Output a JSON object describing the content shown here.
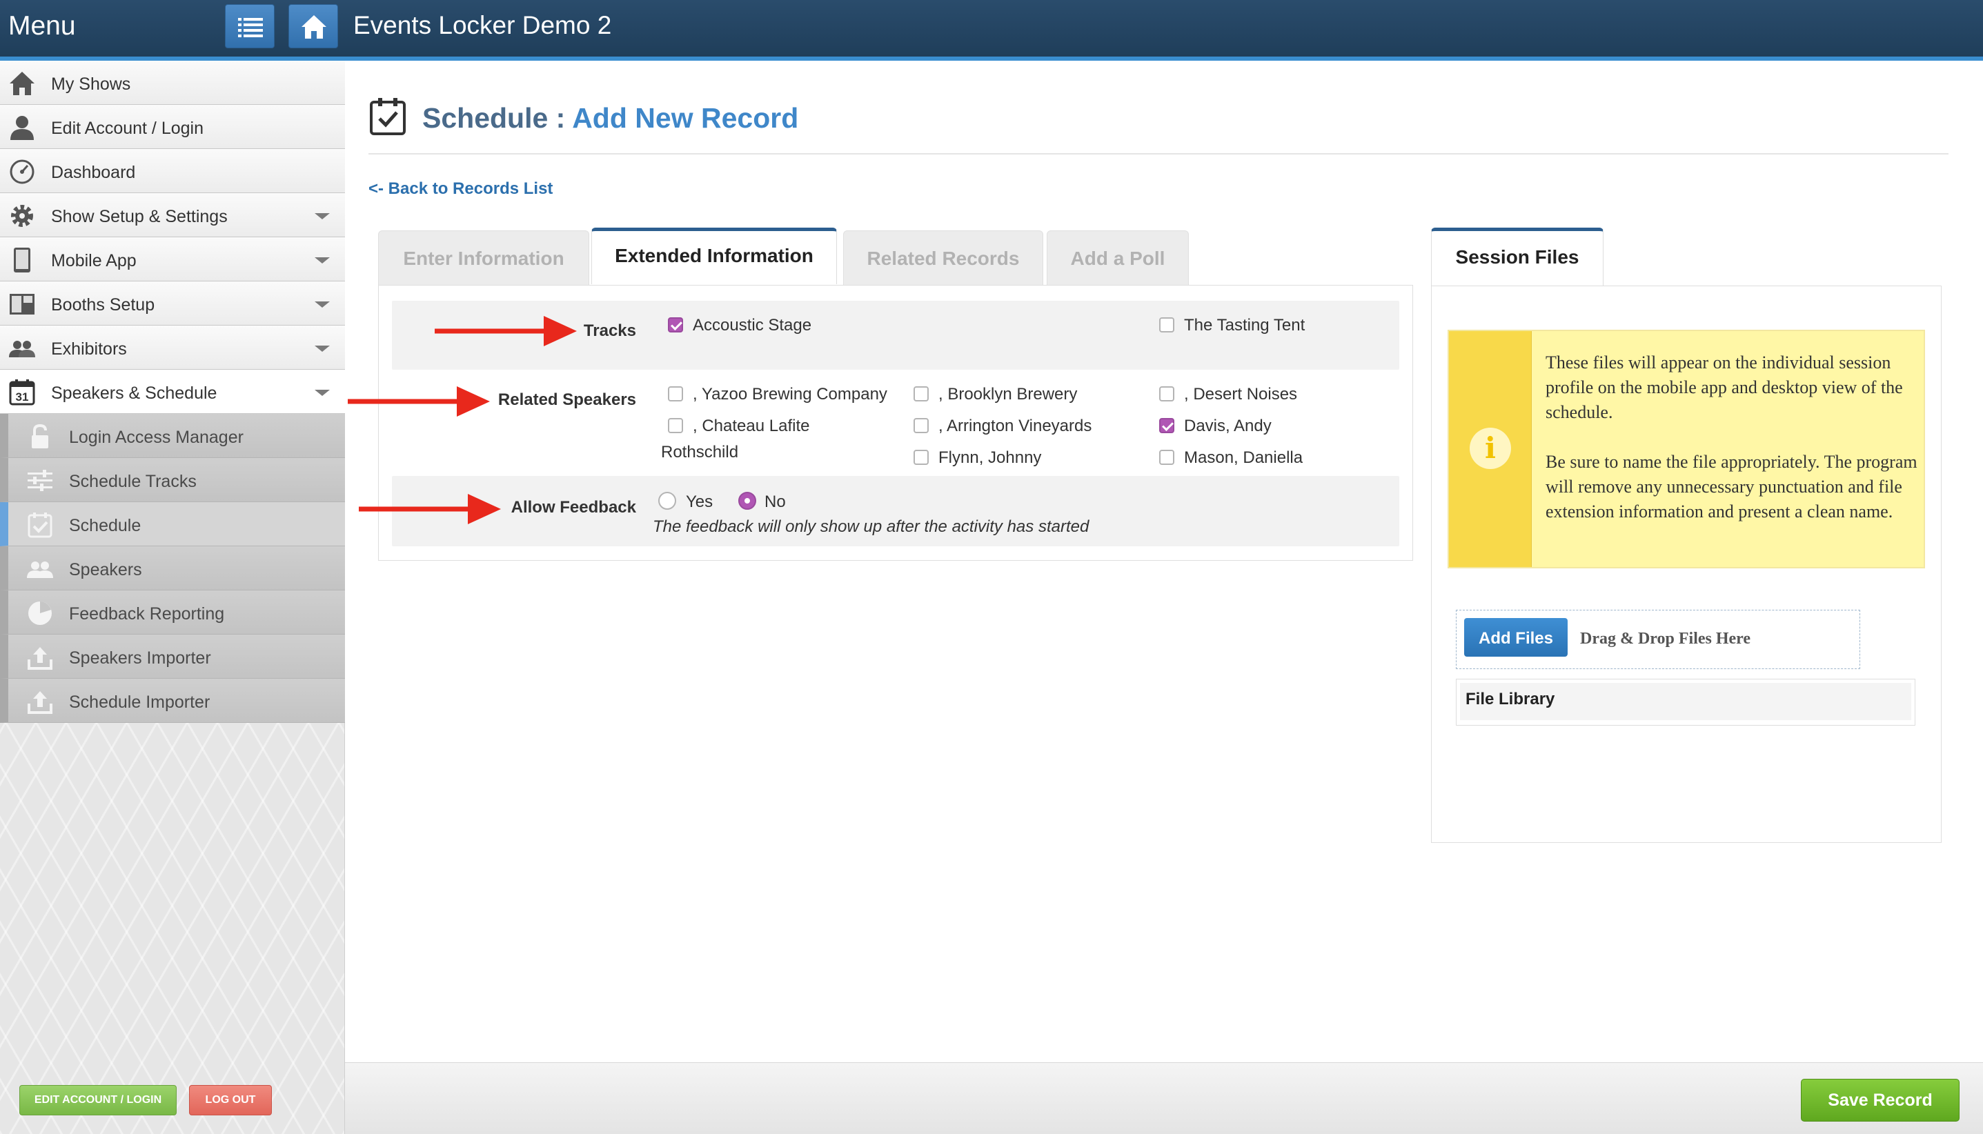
{
  "header": {
    "menu_label": "Menu",
    "app_title": "Events Locker Demo 2",
    "list_icon": "list-icon",
    "home_icon": "home-icon"
  },
  "sidebar": {
    "items": [
      {
        "label": "My Shows",
        "icon": "home-icon"
      },
      {
        "label": "Edit Account / Login",
        "icon": "person-icon"
      },
      {
        "label": "Dashboard",
        "icon": "gauge-icon"
      },
      {
        "label": "Show Setup & Settings",
        "icon": "gear-icon",
        "expandable": true
      },
      {
        "label": "Mobile App",
        "icon": "tablet-icon",
        "expandable": true
      },
      {
        "label": "Booths Setup",
        "icon": "layout-icon",
        "expandable": true
      },
      {
        "label": "Exhibitors",
        "icon": "people-icon",
        "expandable": true
      },
      {
        "label": "Speakers & Schedule",
        "icon": "calendar-icon",
        "icon_text": "31",
        "expandable": true,
        "expanded": true
      }
    ],
    "subitems": [
      {
        "label": "Login Access Manager",
        "icon": "lock-icon"
      },
      {
        "label": "Schedule Tracks",
        "icon": "sliders-icon"
      },
      {
        "label": "Schedule",
        "icon": "calendar-check-icon",
        "active": true
      },
      {
        "label": "Speakers",
        "icon": "people-icon"
      },
      {
        "label": "Feedback Reporting",
        "icon": "pie-chart-icon"
      },
      {
        "label": "Speakers Importer",
        "icon": "upload-icon"
      },
      {
        "label": "Schedule Importer",
        "icon": "upload-icon"
      }
    ],
    "edit_account_button": "EDIT ACCOUNT / LOGIN",
    "logout_button": "LOG OUT"
  },
  "page": {
    "title": "Schedule",
    "separator": " : ",
    "subtitle": "Add New Record",
    "back_link": "<- Back to Records List"
  },
  "tabs": [
    {
      "label": "Enter Information",
      "active": false
    },
    {
      "label": "Extended Information",
      "active": true
    },
    {
      "label": "Related Records",
      "active": false
    },
    {
      "label": "Add a Poll",
      "active": false
    }
  ],
  "form": {
    "tracks": {
      "label": "Tracks",
      "options": [
        {
          "label": "Accoustic Stage",
          "checked": true
        },
        {
          "label": "The Tasting Tent",
          "checked": false
        }
      ]
    },
    "related_speakers": {
      "label": "Related Speakers",
      "options": [
        {
          "label": ", Yazoo Brewing Company",
          "checked": false
        },
        {
          "label": ", Brooklyn Brewery",
          "checked": false
        },
        {
          "label": ", Desert Noises",
          "checked": false
        },
        {
          "label": ", Chateau Lafite",
          "label_cont": "Rothschild",
          "checked": false
        },
        {
          "label": ", Arrington Vineyards",
          "checked": false
        },
        {
          "label": "Davis, Andy",
          "checked": true
        },
        {
          "label": "Flynn, Johnny",
          "checked": false
        },
        {
          "label": "Mason, Daniella",
          "checked": false
        }
      ]
    },
    "allow_feedback": {
      "label": "Allow Feedback",
      "options": [
        {
          "label": "Yes",
          "selected": false
        },
        {
          "label": "No",
          "selected": true
        }
      ],
      "note": "The feedback will only show up after the activity has started"
    }
  },
  "session_files": {
    "tab_label": "Session Files",
    "info_icon": "info-icon",
    "info_paragraph_1": "These files will appear on the individual session profile on the mobile app and desktop view of the schedule.",
    "info_paragraph_2": "Be sure to name the file appropriately. The program will remove any unnecessary punctuation and file extension information and present a clean name.",
    "add_files_button": "Add Files",
    "drag_drop_label": "Drag & Drop Files Here",
    "file_library_label": "File Library"
  },
  "footer": {
    "save_button": "Save Record"
  },
  "colors": {
    "accent": "#3f87c9",
    "checked": "#b056b4",
    "save_green": "#6ab82a",
    "annotation_arrow": "#e8281c"
  }
}
